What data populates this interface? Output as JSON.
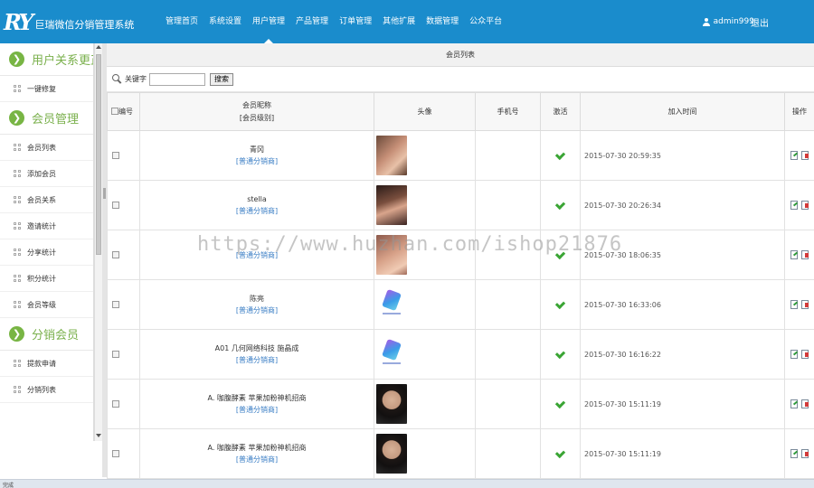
{
  "header": {
    "logo_mark": "RY",
    "app_title": "巨瑞微信分销管理系统",
    "nav": [
      {
        "label": "管理首页",
        "active": false
      },
      {
        "label": "系统设置",
        "active": false
      },
      {
        "label": "用户管理",
        "active": true
      },
      {
        "label": "产品管理",
        "active": false
      },
      {
        "label": "订单管理",
        "active": false
      },
      {
        "label": "其他扩展",
        "active": false
      },
      {
        "label": "数据管理",
        "active": false
      },
      {
        "label": "公众平台",
        "active": false
      }
    ],
    "username": "admin999",
    "logout": "退出"
  },
  "sidebar": {
    "sections": [
      {
        "title": "用户关系更正",
        "items": [
          "一键修复"
        ]
      },
      {
        "title": "会员管理",
        "items": [
          "会员列表",
          "添加会员",
          "会员关系",
          "邀请统计",
          "分享统计",
          "积分统计",
          "会员等级"
        ]
      },
      {
        "title": "分销会员",
        "items": [
          "提款申请",
          "分销列表"
        ]
      }
    ]
  },
  "main": {
    "panel_title": "会员列表",
    "search": {
      "label": "关键字",
      "value": "",
      "button": "搜索"
    },
    "columns": {
      "id": "编号",
      "nick_1": "会员昵称",
      "nick_2": "[会员级别]",
      "avatar": "头像",
      "phone": "手机号",
      "activated": "激活",
      "joined": "加入时间",
      "actions": "操作"
    },
    "rows": [
      {
        "nick": "青冈",
        "level": "[普通分销商]",
        "avatar": "photo",
        "phone": "",
        "activated": true,
        "joined": "2015-07-30 20:59:35"
      },
      {
        "nick": "stella",
        "level": "[普通分销商]",
        "avatar": "photo2",
        "phone": "",
        "activated": true,
        "joined": "2015-07-30 20:26:34"
      },
      {
        "nick": "",
        "level": "[普通分销商]",
        "avatar": "photo3",
        "phone": "",
        "activated": true,
        "joined": "2015-07-30 18:06:35"
      },
      {
        "nick": "陈亮",
        "level": "[普通分销商]",
        "avatar": "logo",
        "phone": "",
        "activated": true,
        "joined": "2015-07-30 16:33:06"
      },
      {
        "nick": "A01 几何网络科技 施晶成",
        "level": "[普通分销商]",
        "avatar": "logo",
        "phone": "",
        "activated": true,
        "joined": "2015-07-30 16:16:22"
      },
      {
        "nick": "A. 咖腹酵素 苹果加粉神机招商",
        "level": "[普通分销商]",
        "avatar": "boy",
        "phone": "",
        "activated": true,
        "joined": "2015-07-30 15:11:19"
      },
      {
        "nick": "A. 咖腹酵素 苹果加粉神机招商",
        "level": "[普通分销商]",
        "avatar": "boy",
        "phone": "",
        "activated": true,
        "joined": "2015-07-30 15:11:19"
      }
    ]
  },
  "watermark": "https://www.huzhan.com/ishop21876",
  "statusbar": {
    "left": "完成"
  },
  "icons": {
    "search": "magnifier-icon",
    "activated": "check-icon",
    "edit": "edit-icon",
    "delete": "delete-icon",
    "section": "arrow-circle-icon",
    "item": "grid-icon",
    "user": "user-icon"
  },
  "colors": {
    "header_bg": "#1a8ccc",
    "accent_green": "#78b544",
    "level_blue": "#3a7ec5"
  }
}
